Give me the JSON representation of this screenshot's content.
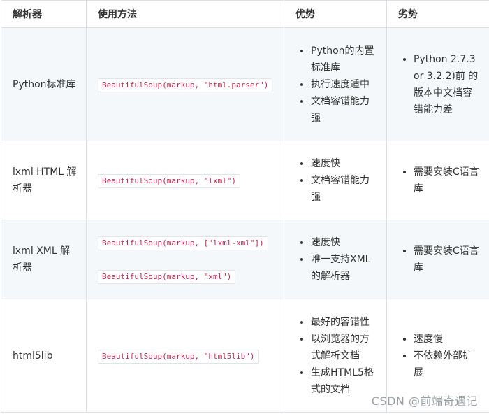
{
  "headers": [
    "解析器",
    "使用方法",
    "优势",
    "劣势"
  ],
  "rows": [
    {
      "parser": "Python标准库",
      "usage": [
        "BeautifulSoup(markup, \"html.parser\")"
      ],
      "pros": [
        "Python的内置标准库",
        "执行速度适中",
        "文档容错能力强"
      ],
      "cons": [
        "Python 2.7.3 or 3.2.2)前 的版本中文档容错能力差"
      ]
    },
    {
      "parser": "lxml HTML 解析器",
      "usage": [
        "BeautifulSoup(markup, \"lxml\")"
      ],
      "pros": [
        "速度快",
        "文档容错能力强"
      ],
      "cons": [
        "需要安装C语言库"
      ]
    },
    {
      "parser": "lxml XML 解析器",
      "usage": [
        "BeautifulSoup(markup, [\"lxml-xml\"])",
        "BeautifulSoup(markup, \"xml\")"
      ],
      "pros": [
        "速度快",
        "唯一支持XML的解析器"
      ],
      "cons": [
        "需要安装C语言库"
      ]
    },
    {
      "parser": "html5lib",
      "usage": [
        "BeautifulSoup(markup, \"html5lib\")"
      ],
      "pros": [
        "最好的容错性",
        "以浏览器的方式解析文档",
        "生成HTML5格式的文档"
      ],
      "cons": [
        "速度慢",
        "不依赖外部扩展"
      ]
    }
  ],
  "watermark": "CSDN @前端奇遇记"
}
